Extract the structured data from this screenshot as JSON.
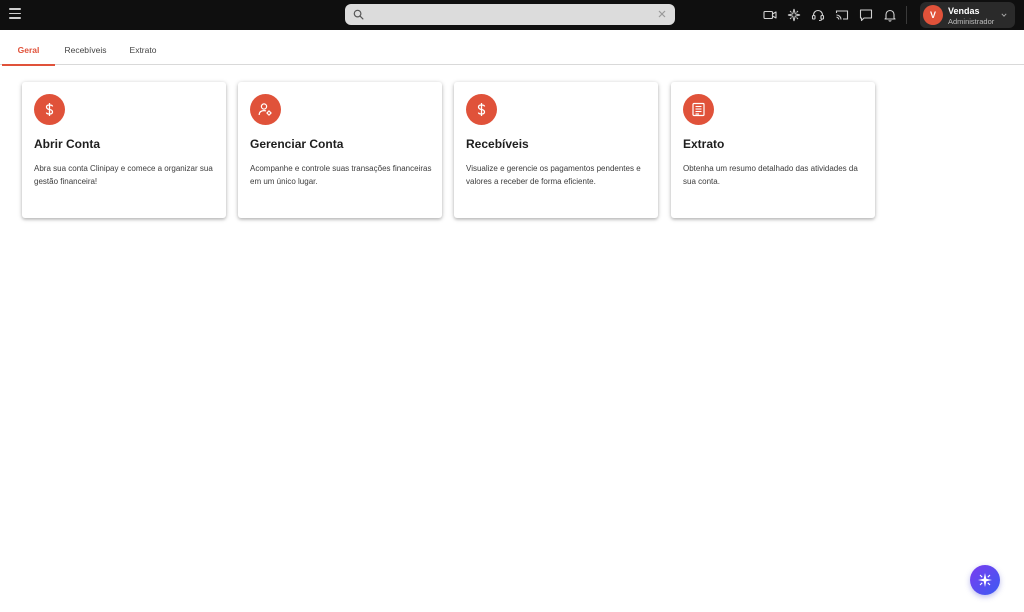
{
  "topbar": {
    "search": {
      "placeholder": "",
      "value": ""
    },
    "icons": [
      "video-icon",
      "sparkle-icon",
      "headset-icon",
      "cast-icon",
      "chat-icon",
      "bell-icon"
    ],
    "user": {
      "initial": "V",
      "name": "Vendas",
      "role": "Administrador"
    }
  },
  "tabs": [
    {
      "label": "Geral",
      "active": true
    },
    {
      "label": "Recebíveis",
      "active": false
    },
    {
      "label": "Extrato",
      "active": false
    }
  ],
  "cards": [
    {
      "icon": "dollar-icon",
      "title": "Abrir Conta",
      "description": "Abra sua conta Clinipay e comece a organizar sua gestão financeira!"
    },
    {
      "icon": "user-settings-icon",
      "title": "Gerenciar Conta",
      "description": "Acompanhe e controle suas transações financeiras em um único lugar."
    },
    {
      "icon": "dollar-icon",
      "title": "Recebíveis",
      "description": "Visualize e gerencie os pagamentos pendentes e valores a receber de forma eficiente."
    },
    {
      "icon": "document-icon",
      "title": "Extrato",
      "description": "Obtenha um resumo detalhado das atividades da sua conta."
    }
  ],
  "fab": {
    "icon": "sparkle-icon"
  },
  "colors": {
    "accent": "#e0523a",
    "topbar": "#0f0f0f",
    "fab_start": "#7a3cf0",
    "fab_end": "#3b5bf2"
  }
}
